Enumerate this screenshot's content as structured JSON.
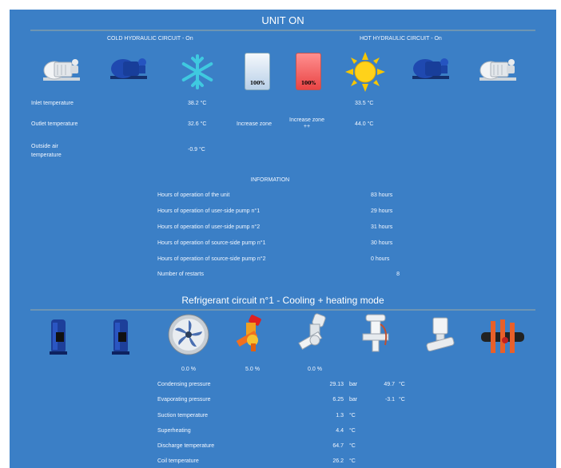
{
  "header": {
    "title": "UNIT ON"
  },
  "hydraulic": {
    "cold_title": "COLD HYDRAULIC CIRCUIT - On",
    "hot_title": "HOT HYDRAULIC CIRCUIT - On",
    "cold_gauge_label": "100%",
    "hot_gauge_label": "100%",
    "rows": {
      "inlet": {
        "label": "Inlet temperature",
        "cold": "38.2 °C",
        "hot": "33.5 °C"
      },
      "outlet": {
        "label": "Outlet temperature",
        "cold": "32.6 °C",
        "zone1": "Increase zone",
        "zone2_line1": "Increase zone",
        "zone2_line2": "++",
        "hot": "44.0 °C"
      },
      "outside": {
        "label_line1": "Outside air",
        "label_line2": "temperature",
        "cold": "-0.9 °C"
      }
    }
  },
  "information": {
    "title": "INFORMATION",
    "rows": [
      {
        "label": "Hours of operation of the unit",
        "value": "83 hours"
      },
      {
        "label": "Hours of operation of user-side pump n°1",
        "value": "29 hours"
      },
      {
        "label": "Hours of operation of user-side pump n°2",
        "value": "31 hours"
      },
      {
        "label": "Hours of operation of source-side pump n°1",
        "value": "30 hours"
      },
      {
        "label": "Hours of operation of source-side pump n°2",
        "value": "0 hours"
      },
      {
        "label": "Number of restarts",
        "value": "8"
      }
    ]
  },
  "refrigerant": {
    "title": "Refrigerant circuit n°1 - Cooling + heating mode",
    "fan_pct": "0.0 %",
    "valve1_pct": "5.0 %",
    "valve2_pct": "0.0 %",
    "rows": [
      {
        "label": "Condensing pressure",
        "value": "29.13",
        "unit": "bar",
        "value2": "49.7",
        "unit2": "°C"
      },
      {
        "label": "Evaporating pressure",
        "value": "6.25",
        "unit": "bar",
        "value2": "-3.1",
        "unit2": "°C"
      },
      {
        "label": "Suction temperature",
        "value": "1.3",
        "unit": "°C"
      },
      {
        "label": "Superheating",
        "value": "4.4",
        "unit": "°C"
      },
      {
        "label": "Discharge temperature",
        "value": "64.7",
        "unit": "°C"
      },
      {
        "label": "Coil temperature",
        "value": "26.2",
        "unit": "°C"
      }
    ]
  },
  "colors": {
    "panel": "#3b7fc6",
    "divider": "#6e95b3",
    "sun": "#f7c600",
    "snow": "#3fc9e0",
    "pump": "#1d3f9a"
  },
  "icons": [
    "pump-icon-white",
    "pump-icon-blue",
    "snowflake-icon",
    "cold-gauge-icon",
    "hot-gauge-icon",
    "sun-icon",
    "compressor-icon",
    "fan-icon",
    "valve-icon",
    "solenoid-valve-icon",
    "pipe-heater-icon"
  ]
}
